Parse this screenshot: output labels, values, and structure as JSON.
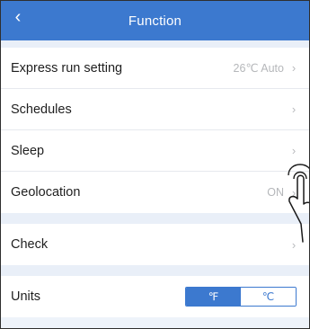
{
  "header": {
    "title": "Function",
    "back_icon": "chevron-left-icon"
  },
  "rows": [
    {
      "label": "Express run setting",
      "value": "26℃ Auto",
      "chev": "›"
    },
    {
      "label": "Schedules",
      "value": "",
      "chev": "›"
    },
    {
      "label": "Sleep",
      "value": "",
      "chev": "›"
    },
    {
      "label": "Geolocation",
      "value": "ON",
      "chev": "›"
    }
  ],
  "check": {
    "label": "Check",
    "chev": "›"
  },
  "units": {
    "label": "Units",
    "options": [
      "℉",
      "℃"
    ],
    "selected": 0
  },
  "colors": {
    "accent": "#3c79cf",
    "background": "#eef3fa",
    "muted_text": "#b5b7ba"
  }
}
